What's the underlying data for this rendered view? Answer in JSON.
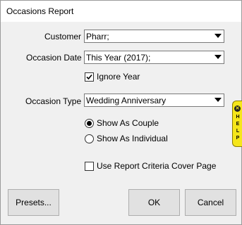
{
  "window": {
    "title": "Occasions Report"
  },
  "form": {
    "customer": {
      "label": "Customer",
      "value": "Pharr;"
    },
    "occasion_date": {
      "label": "Occasion Date",
      "value": "This Year (2017);"
    },
    "ignore_year": {
      "label": "Ignore Year",
      "checked": true
    },
    "occasion_type": {
      "label": "Occasion Type",
      "value": "Wedding Anniversary"
    },
    "show_as_couple": {
      "label": "Show As Couple",
      "selected": true
    },
    "show_as_individual": {
      "label": "Show As Individual",
      "selected": false
    },
    "cover_page": {
      "label": "Use Report Criteria Cover Page",
      "checked": false
    }
  },
  "buttons": {
    "presets": "Presets...",
    "ok": "OK",
    "cancel": "Cancel"
  },
  "help_tab": {
    "icon": "close-icon",
    "letters": [
      "H",
      "E",
      "L",
      "P"
    ],
    "color": "#f5e61a"
  }
}
